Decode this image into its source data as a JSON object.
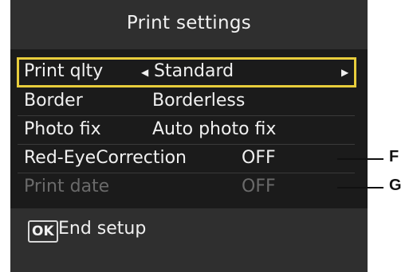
{
  "header": {
    "title": "Print settings"
  },
  "menu": {
    "items": [
      {
        "label": "Print qlty",
        "value": "Standard",
        "selected": true
      },
      {
        "label": "Border",
        "value": "Borderless"
      },
      {
        "label": "Photo fix",
        "value": "Auto photo fix"
      },
      {
        "label": "Red-EyeCorrection",
        "value": "OFF"
      },
      {
        "label": "Print date",
        "value": "OFF",
        "disabled": true
      }
    ]
  },
  "footer": {
    "key": "OK",
    "text": "End setup"
  },
  "callouts": {
    "f": "F",
    "g": "G"
  }
}
